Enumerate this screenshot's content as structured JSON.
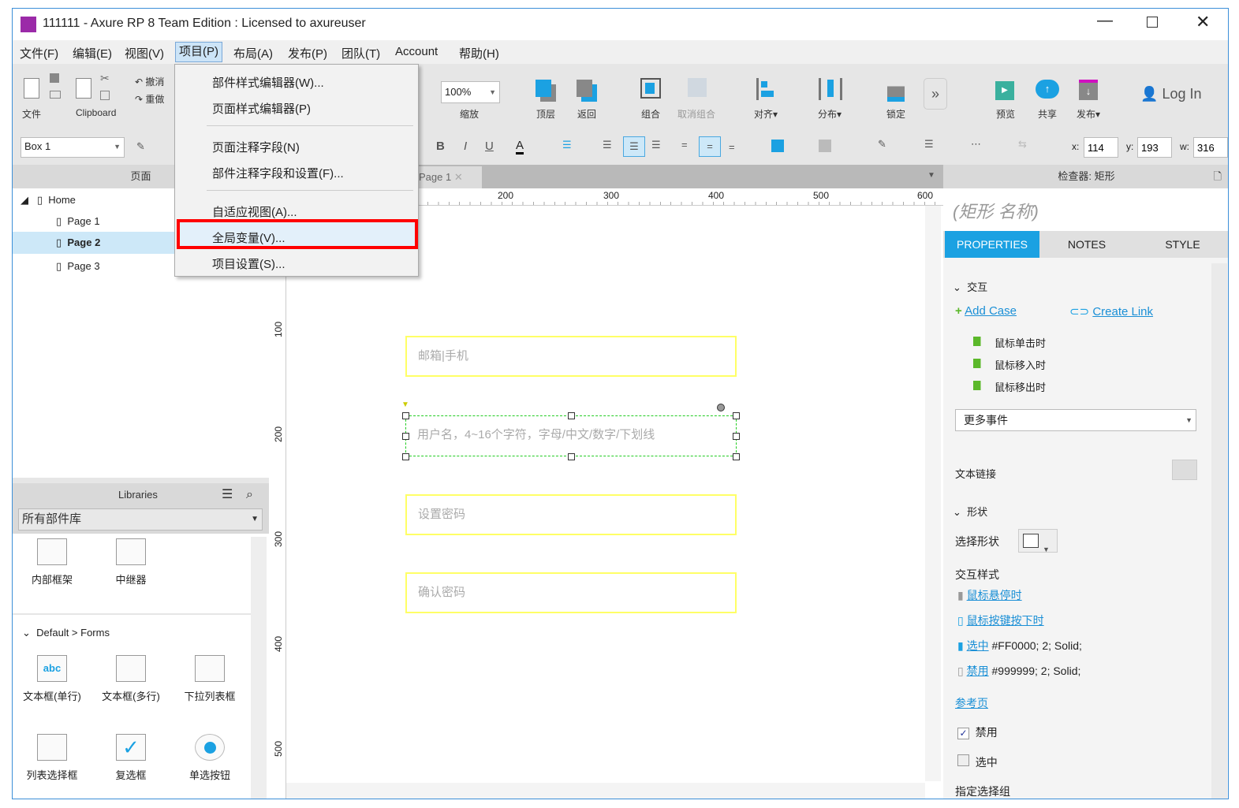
{
  "window": {
    "title": "111111 - Axure RP 8 Team Edition : Licensed to axureuser",
    "controls": [
      "minimize",
      "maximize",
      "close"
    ]
  },
  "menubar": [
    "文件(F)",
    "编辑(E)",
    "视图(V)",
    "项目(P)",
    "布局(A)",
    "发布(P)",
    "团队(T)",
    "Account",
    "帮助(H)"
  ],
  "toolbar": {
    "file": "文件",
    "clipboard": "Clipboard",
    "undo": "撤消",
    "redo": "重做",
    "zoom_value": "100%",
    "zoom": "缩放",
    "top": "顶层",
    "back": "返回",
    "group": "组合",
    "ungroup": "取消组合",
    "align": "对齐▾",
    "distribute": "分布▾",
    "lock": "锁定",
    "preview": "预览",
    "share": "共享",
    "publish": "发布▾",
    "login": "Log In"
  },
  "format": {
    "widget_name": "Box 1",
    "x_label": "x:",
    "x": "114",
    "y_label": "y:",
    "y": "193",
    "w_label": "w:",
    "w": "316",
    "bold": "B",
    "italic": "I",
    "underline": "U",
    "font_color": "A"
  },
  "pages": {
    "header": "页面",
    "tree": [
      {
        "label": "Home"
      },
      {
        "label": "Page 1"
      },
      {
        "label": "Page 2"
      },
      {
        "label": "Page 3"
      }
    ]
  },
  "libraries": {
    "header": "Libraries",
    "selected": "所有部件库",
    "top_items": [
      "内部框架",
      "中继器"
    ],
    "section": "Default > Forms",
    "items": [
      "文本框(单行)",
      "文本框(多行)",
      "下拉列表框",
      "列表选择框",
      "复选框",
      "单选按钮"
    ]
  },
  "project_menu": {
    "items": [
      "部件样式编辑器(W)...",
      "页面样式编辑器(P)",
      "页面注释字段(N)",
      "部件注释字段和设置(F)...",
      "自适应视图(A)...",
      "全局变量(V)...",
      "项目设置(S)..."
    ],
    "highlighted": "全局变量(V)..."
  },
  "canvas": {
    "tab": "Page 1",
    "ruler_top": [
      "200",
      "300",
      "400",
      "500",
      "600"
    ],
    "ruler_left": [
      "100",
      "200",
      "300",
      "400",
      "500"
    ],
    "boxes": [
      "邮箱|手机",
      "用户名，4~16个字符，字母/中文/数字/下划线",
      "设置密码",
      "确认密码"
    ],
    "box_border_color": "#FFFF66",
    "selection_color": "#00CC00"
  },
  "inspector": {
    "header": "检查器: 矩形",
    "name_placeholder": "(矩形 名称)",
    "tabs": [
      "PROPERTIES",
      "NOTES",
      "STYLE"
    ],
    "active_tab": "PROPERTIES",
    "interaction": "交互",
    "add_case": "Add Case",
    "create_link": "Create Link",
    "events": [
      "鼠标单击时",
      "鼠标移入时",
      "鼠标移出时"
    ],
    "more_events": "更多事件",
    "text_link": "文本链接",
    "shape": "形状",
    "select_shape": "选择形状",
    "interaction_styles": "交互样式",
    "styles": [
      {
        "label": "鼠标悬停时",
        "value": ""
      },
      {
        "label": "鼠标按键按下时",
        "value": ""
      },
      {
        "label": "选中",
        "value": "#FF0000; 2; Solid;"
      },
      {
        "label": "禁用",
        "value": "#999999; 2; Solid;"
      }
    ],
    "reference_page": "参考页",
    "disabled": "禁用",
    "disabled_checked": true,
    "selected": "选中",
    "selected_checked": false,
    "selection_group": "指定选择组"
  },
  "colors": {
    "accent": "#1BA1E2",
    "highlight_box": "#FF0000"
  }
}
